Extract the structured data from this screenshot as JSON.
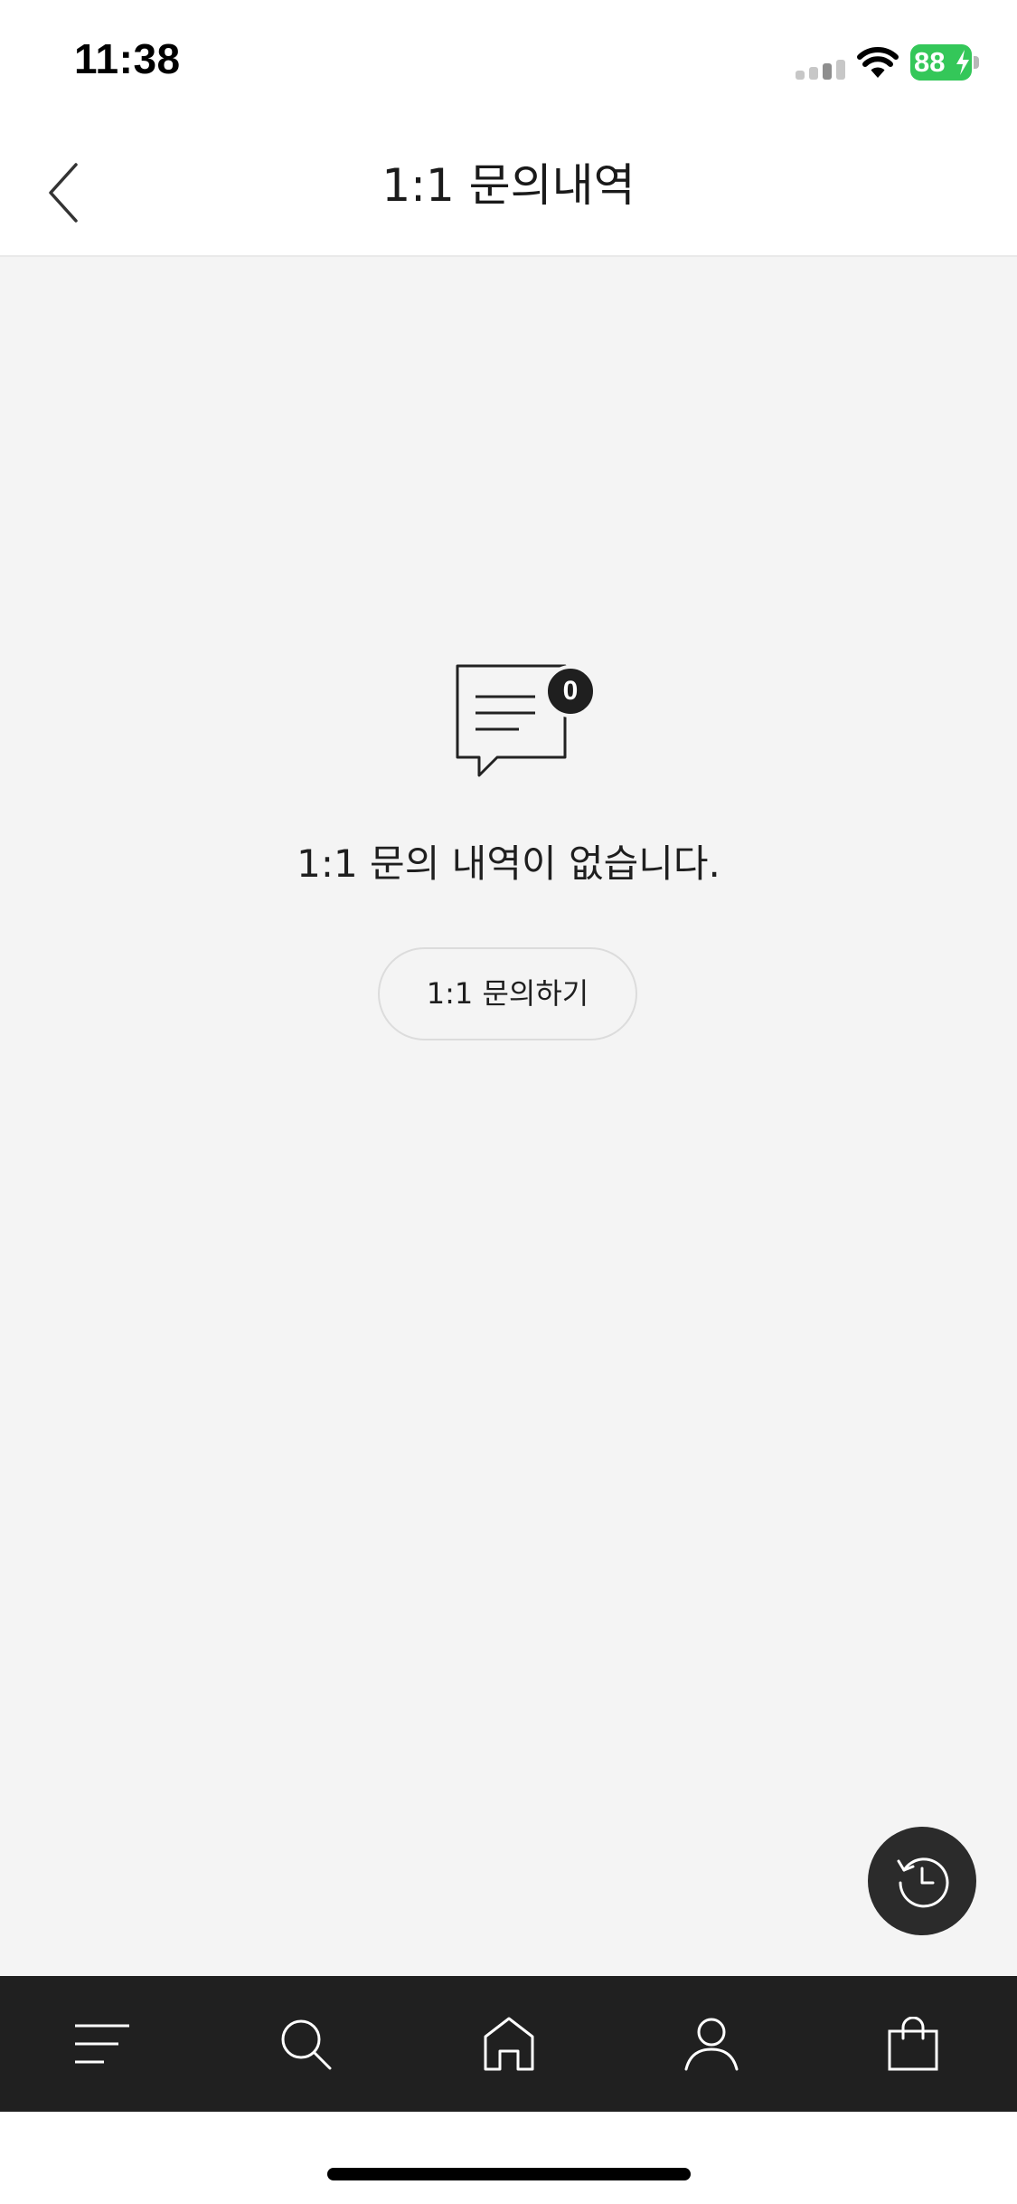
{
  "status_bar": {
    "time": "11:38",
    "battery_level": "88",
    "battery_color": "#34c759",
    "icons": [
      "signal-icon",
      "wifi-icon",
      "battery-icon",
      "charging-bolt-icon"
    ]
  },
  "header": {
    "title": "1:1 문의내역",
    "back_icon": "chevron-left-icon"
  },
  "empty_state": {
    "icon": "chat-bubble-icon",
    "badge_count": "0",
    "message": "1:1 문의 내역이 없습니다.",
    "button_label": "1:1 문의하기"
  },
  "floating_button": {
    "icon": "history-icon"
  },
  "tab_bar": {
    "background": "#202020",
    "items": [
      {
        "icon": "menu-icon"
      },
      {
        "icon": "search-icon"
      },
      {
        "icon": "home-icon"
      },
      {
        "icon": "user-icon"
      },
      {
        "icon": "shopping-bag-icon"
      }
    ]
  }
}
